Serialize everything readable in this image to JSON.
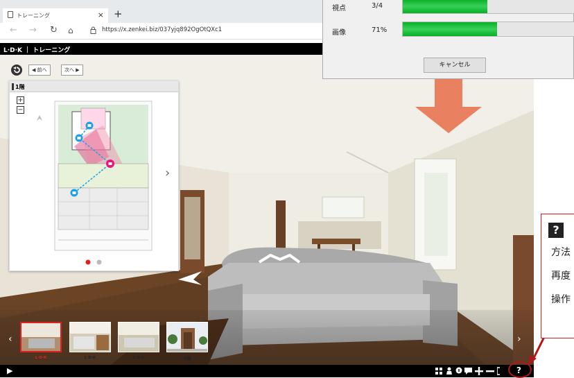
{
  "browser": {
    "tab_title": "トレーニング",
    "url": "https://x.zenkei.biz/037yjq892OgOtQXc1",
    "new_tab": "+",
    "close": "×"
  },
  "app_header": {
    "title": "L·D·K ｜ トレーニング"
  },
  "toolbar": {
    "prev_label": "◀ 前へ",
    "next_label": "次へ ▶"
  },
  "map_panel": {
    "floor_label": "1階",
    "zoom_in": "+",
    "zoom_out": "−",
    "next_arrow": "›"
  },
  "dialog": {
    "rows": [
      {
        "label": "視点",
        "value": "3/4",
        "progress": 0.49
      },
      {
        "label": "画像",
        "value": "71%",
        "progress": 0.55
      }
    ],
    "cancel_label": "キャンセル"
  },
  "thumbnails": [
    {
      "label": "L·D·K",
      "selected": true
    },
    {
      "label": "L·D·K",
      "selected": false
    },
    {
      "label": "L·D·K",
      "selected": false
    },
    {
      "label": "外観",
      "selected": false
    }
  ],
  "bottom_bar": {
    "play_icon": "▶",
    "help": "?"
  },
  "callout": {
    "icon_text": "?",
    "lines": [
      "方法",
      "再度",
      "操作"
    ]
  },
  "colors": {
    "accent_red": "#e02020",
    "arrow_orange": "#e98060",
    "progress_green": "#06b025",
    "map_marker_blue": "#1aa0e8",
    "map_marker_pink": "#e8157a"
  }
}
